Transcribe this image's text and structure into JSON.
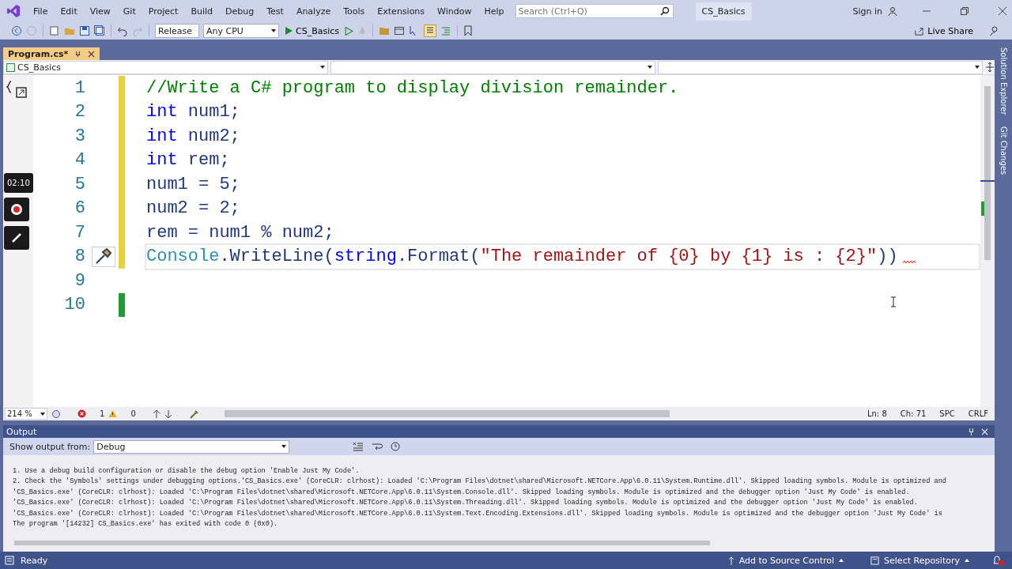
{
  "menu": {
    "items": [
      "File",
      "Edit",
      "View",
      "Git",
      "Project",
      "Build",
      "Debug",
      "Test",
      "Analyze",
      "Tools",
      "Extensions",
      "Window",
      "Help"
    ]
  },
  "search": {
    "placeholder": "Search (Ctrl+Q)"
  },
  "solution_name": "CS_Basics",
  "sign_in": "Sign in",
  "toolbar": {
    "configuration": "Release",
    "platform": "Any CPU",
    "startup": "CS_Basics",
    "live_share": "Live Share"
  },
  "tabs": [
    {
      "label": "Program.cs*",
      "selected": true
    }
  ],
  "nav": {
    "project": "CS_Basics"
  },
  "side_tabs": [
    "Solution Explorer",
    "Git Changes"
  ],
  "recorder": {
    "timer": "02:10"
  },
  "editor": {
    "lines": [
      {
        "number": "1",
        "modified": true,
        "saved": false,
        "current": false,
        "tokens": [
          {
            "kind": "comment",
            "text": "//Write a C# program to display division remainder."
          }
        ]
      },
      {
        "number": "2",
        "modified": true,
        "saved": false,
        "current": false,
        "tokens": [
          {
            "kind": "keyword",
            "text": "int"
          },
          {
            "kind": "plain",
            "text": " num1;"
          }
        ]
      },
      {
        "number": "3",
        "modified": true,
        "saved": false,
        "current": false,
        "tokens": [
          {
            "kind": "keyword",
            "text": "int"
          },
          {
            "kind": "plain",
            "text": " num2;"
          }
        ]
      },
      {
        "number": "4",
        "modified": true,
        "saved": false,
        "current": false,
        "tokens": [
          {
            "kind": "keyword",
            "text": "int"
          },
          {
            "kind": "plain",
            "text": " rem;"
          }
        ]
      },
      {
        "number": "5",
        "modified": true,
        "saved": false,
        "current": false,
        "tokens": [
          {
            "kind": "plain",
            "text": "num1 = 5;"
          }
        ]
      },
      {
        "number": "6",
        "modified": true,
        "saved": false,
        "current": false,
        "tokens": [
          {
            "kind": "plain",
            "text": "num2 = 2;"
          }
        ]
      },
      {
        "number": "7",
        "modified": true,
        "saved": false,
        "current": false,
        "tokens": [
          {
            "kind": "plain",
            "text": "rem = num1 % num2;"
          }
        ]
      },
      {
        "number": "8",
        "modified": true,
        "saved": false,
        "current": true,
        "error": true,
        "tokens": [
          {
            "kind": "type",
            "text": "Console"
          },
          {
            "kind": "plain",
            "text": ".WriteLine("
          },
          {
            "kind": "keyword",
            "text": "string"
          },
          {
            "kind": "plain",
            "text": ".Format("
          },
          {
            "kind": "string",
            "text": "\"The remainder of {0} by {1} is : {2}\""
          },
          {
            "kind": "plain",
            "text": "))"
          }
        ]
      },
      {
        "number": "9",
        "modified": false,
        "current": false
      },
      {
        "number": "10",
        "modified": true,
        "saved": true,
        "current": false
      }
    ]
  },
  "editor_status": {
    "zoom": "214 %",
    "errors": "1",
    "warnings": "0",
    "line": "Ln: 8",
    "column": "Ch: 71",
    "indent": "SPC",
    "line_ending": "CRLF"
  },
  "output": {
    "title": "Output",
    "source_label": "Show output from:",
    "source": "Debug",
    "lines": [
      "1. Use a debug build configuration or disable the debug option 'Enable Just My Code'.",
      "2. Check the 'Symbols' settings under debugging options.'CS_Basics.exe' (CoreCLR: clrhost): Loaded 'C:\\Program Files\\dotnet\\shared\\Microsoft.NETCore.App\\6.0.11\\System.Runtime.dll'. Skipped loading symbols. Module is optimized and",
      "'CS_Basics.exe' (CoreCLR: clrhost): Loaded 'C:\\Program Files\\dotnet\\shared\\Microsoft.NETCore.App\\6.0.11\\System.Console.dll'. Skipped loading symbols. Module is optimized and the debugger option 'Just My Code' is enabled.",
      "'CS_Basics.exe' (CoreCLR: clrhost): Loaded 'C:\\Program Files\\dotnet\\shared\\Microsoft.NETCore.App\\6.0.11\\System.Threading.dll'. Skipped loading symbols. Module is optimized and the debugger option 'Just My Code' is enabled.",
      "'CS_Basics.exe' (CoreCLR: clrhost): Loaded 'C:\\Program Files\\dotnet\\shared\\Microsoft.NETCore.App\\6.0.11\\System.Text.Encoding.Extensions.dll'. Skipped loading symbols. Module is optimized and the debugger option 'Just My Code' is",
      "The program '[14232] CS_Basics.exe' has exited with code 0 (0x0)."
    ]
  },
  "status_bar": {
    "state": "Ready",
    "source_control": "Add to Source Control",
    "repository": "Select Repository"
  }
}
